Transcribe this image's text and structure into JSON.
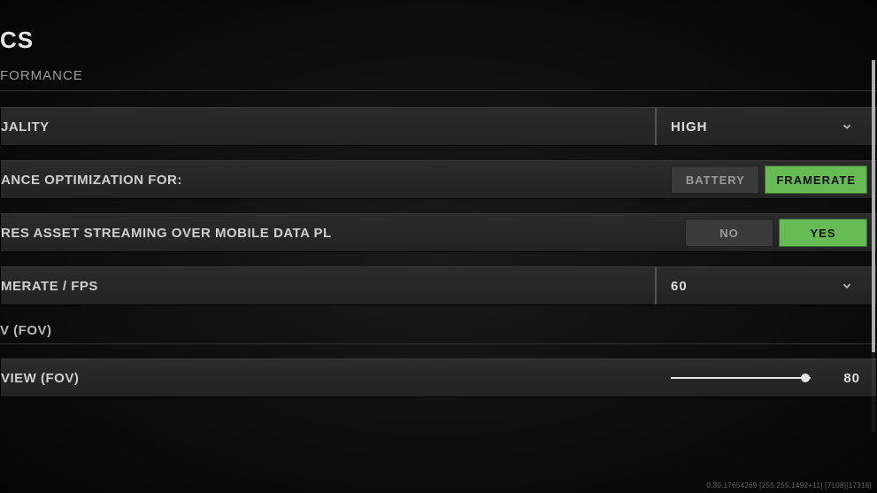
{
  "header": {
    "title_suffix": "CS",
    "section": "FORMANCE"
  },
  "rows": {
    "quality": {
      "label": "JALITY",
      "value": "HIGH"
    },
    "optimize": {
      "label": "ANCE OPTIMIZATION FOR:",
      "options": [
        "BATTERY",
        "FRAMERATE"
      ],
      "selected_index": 1
    },
    "streaming": {
      "label": "RES ASSET STREAMING OVER MOBILE DATA PL",
      "options": [
        "NO",
        "YES"
      ],
      "selected_index": 1
    },
    "fps": {
      "label": "MERATE / FPS",
      "value": "60"
    },
    "fov_header": {
      "label": "V (FOV)"
    },
    "fov": {
      "label": "VIEW (FOV)",
      "value": "80",
      "thumb_percent": 96
    }
  },
  "debug_text": "0.30.17654269 [255.255.1492+11] [7108][17318]"
}
